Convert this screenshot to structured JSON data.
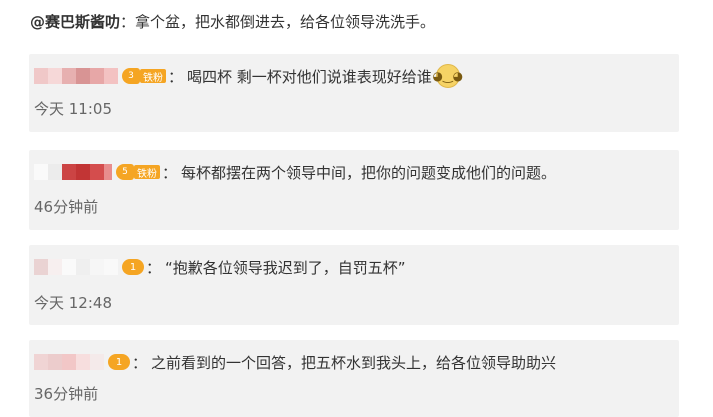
{
  "post": {
    "author": "@赛巴斯酱叻",
    "colon": "：",
    "content": "拿个盆，把水都倒进去，给各位领导洗洗手。"
  },
  "replies": [
    {
      "badge_level": "3",
      "badge_label": "铁粉",
      "text": "喝四杯 剩一杯对他们说谁表现好给谁",
      "emoji": "doge",
      "time": "今天 11:05"
    },
    {
      "badge_level": "5",
      "badge_label": "铁粉",
      "text": "每杯都摆在两个领导中间，把你的问题变成他们的问题。",
      "time": "46分钟前"
    },
    {
      "badge_level": "1",
      "text": "“抱歉各位领导我迟到了，自罚五杯”",
      "time": "今天 12:48"
    },
    {
      "badge_level": "1",
      "text": "之前看到的一个回答，把五杯水到我头上，给各位领导助助兴",
      "time": "36分钟前"
    }
  ],
  "colors": {
    "reply_bg": "#f2f2f2",
    "badge_orange": "#f5a523",
    "time_gray": "#666666"
  },
  "icons": {
    "fan_badge": "heart-level-badge-icon",
    "emoji": "doge-emoji-icon"
  }
}
